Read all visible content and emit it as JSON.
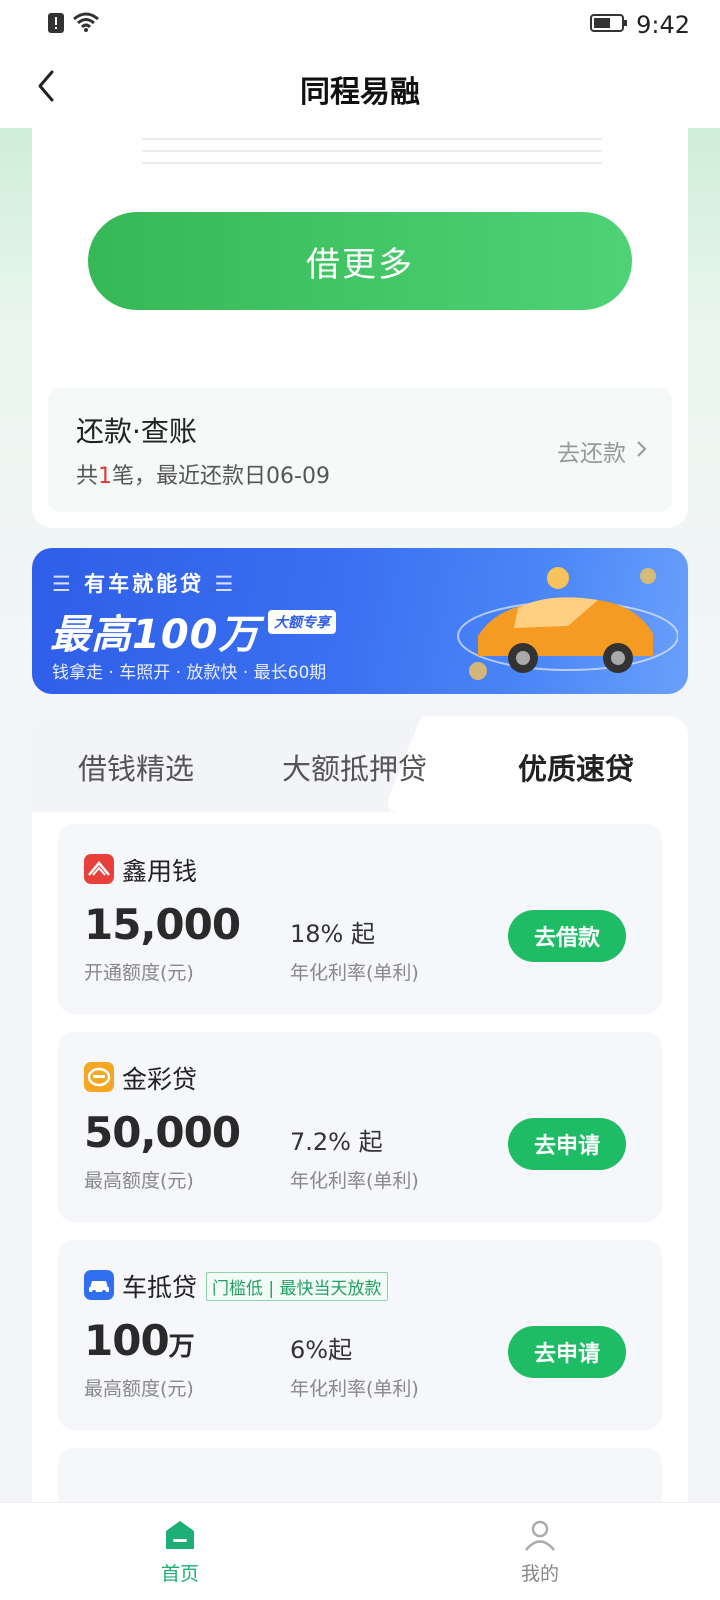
{
  "status_bar": {
    "time": "9:42"
  },
  "nav": {
    "title": "同程易融"
  },
  "hero": {
    "borrow_more_label": "借更多",
    "repay": {
      "title": "还款·查账",
      "sub_prefix": "共",
      "sub_count": "1",
      "sub_suffix": "笔，最近还款日06-09",
      "link_label": "去还款"
    }
  },
  "banner": {
    "kicker": "有车就能贷",
    "headline": "最高100万",
    "tag": "大额专享",
    "sub": "钱拿走 · 车照开 · 放款快 · 最长60期"
  },
  "tabs": [
    {
      "label": "借钱精选"
    },
    {
      "label": "大额抵押贷"
    },
    {
      "label": "优质速贷"
    }
  ],
  "products": [
    {
      "name": "鑫用钱",
      "amount": "15,000",
      "amount_label": "开通额度(元)",
      "rate": "18% 起",
      "rate_label": "年化利率(单利)",
      "button": "去借款",
      "icon_color": "#e8413c"
    },
    {
      "name": "金彩贷",
      "amount": "50,000",
      "amount_label": "最高额度(元)",
      "rate": "7.2% 起",
      "rate_label": "年化利率(单利)",
      "button": "去申请",
      "icon_color": "#f5a623"
    },
    {
      "name": "车抵贷",
      "tag": "门槛低 | 最快当天放款",
      "amount_num": "100",
      "amount_unit": "万",
      "amount_label": "最高额度(元)",
      "rate": "6%起",
      "rate_label": "年化利率(单利)",
      "button": "去申请",
      "icon_color": "#2f6ff0"
    }
  ],
  "tabbar": {
    "home": "首页",
    "mine": "我的"
  }
}
